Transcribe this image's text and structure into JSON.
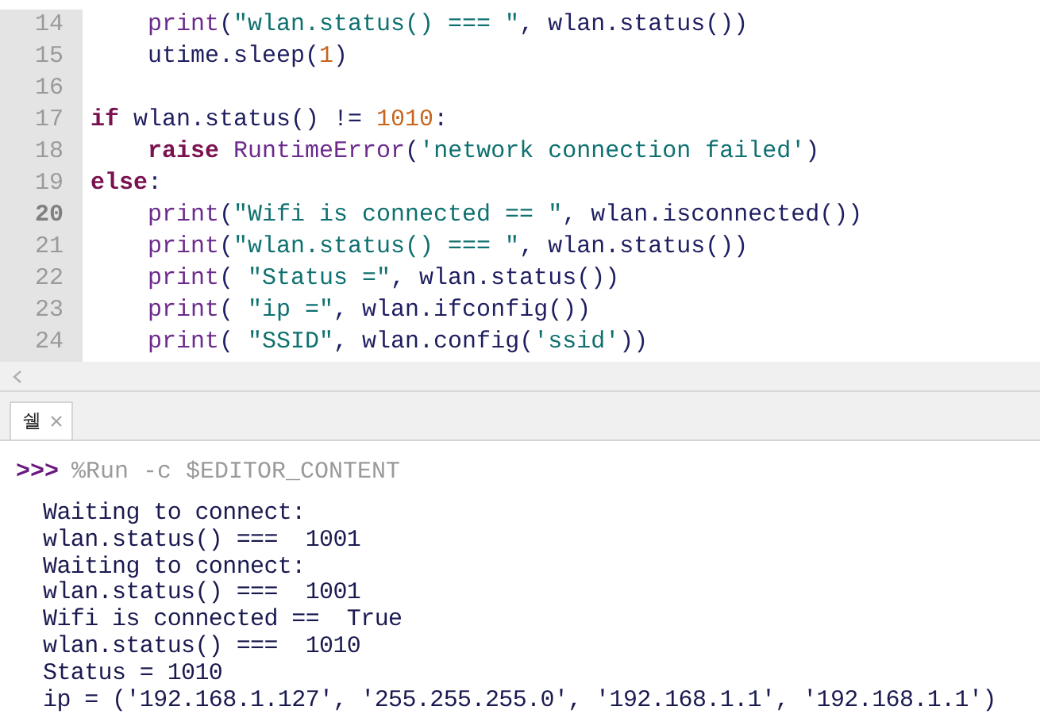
{
  "editor": {
    "lines": [
      {
        "number": "14",
        "current": false,
        "tokens": [
          {
            "kind": "builtin",
            "text": "    print"
          },
          {
            "kind": "plain",
            "text": "("
          },
          {
            "kind": "string",
            "text": "\"wlan.status() === \""
          },
          {
            "kind": "plain",
            "text": ", wlan.status())"
          }
        ]
      },
      {
        "number": "15",
        "current": false,
        "tokens": [
          {
            "kind": "plain",
            "text": "    utime.sleep("
          },
          {
            "kind": "number",
            "text": "1"
          },
          {
            "kind": "plain",
            "text": ")"
          }
        ]
      },
      {
        "number": "16",
        "current": false
      },
      {
        "number": "17",
        "current": false,
        "tokens": [
          {
            "kind": "keyword",
            "text": "if"
          },
          {
            "kind": "plain",
            "text": " wlan.status() != "
          },
          {
            "kind": "number",
            "text": "1010"
          },
          {
            "kind": "plain",
            "text": ":"
          }
        ]
      },
      {
        "number": "18",
        "current": false,
        "tokens": [
          {
            "kind": "keyword",
            "text": "    raise"
          },
          {
            "kind": "builtin",
            "text": " RuntimeError"
          },
          {
            "kind": "plain",
            "text": "("
          },
          {
            "kind": "string",
            "text": "'network connection failed'"
          },
          {
            "kind": "plain",
            "text": ")"
          }
        ]
      },
      {
        "number": "19",
        "current": false,
        "tokens": [
          {
            "kind": "keyword",
            "text": "else"
          },
          {
            "kind": "plain",
            "text": ":"
          }
        ]
      },
      {
        "number": "20",
        "current": true,
        "tokens": [
          {
            "kind": "builtin",
            "text": "    print"
          },
          {
            "kind": "plain",
            "text": "("
          },
          {
            "kind": "string",
            "text": "\"Wifi is connected == \""
          },
          {
            "kind": "plain",
            "text": ", wlan.isconnected())"
          }
        ]
      },
      {
        "number": "21",
        "current": false,
        "tokens": [
          {
            "kind": "builtin",
            "text": "    print"
          },
          {
            "kind": "plain",
            "text": "("
          },
          {
            "kind": "string",
            "text": "\"wlan.status() === \""
          },
          {
            "kind": "plain",
            "text": ", wlan.status())"
          }
        ]
      },
      {
        "number": "22",
        "current": false,
        "tokens": [
          {
            "kind": "builtin",
            "text": "    print"
          },
          {
            "kind": "plain",
            "text": "( "
          },
          {
            "kind": "string",
            "text": "\"Status =\""
          },
          {
            "kind": "plain",
            "text": ", wlan.status())"
          }
        ]
      },
      {
        "number": "23",
        "current": false,
        "tokens": [
          {
            "kind": "builtin",
            "text": "    print"
          },
          {
            "kind": "plain",
            "text": "( "
          },
          {
            "kind": "string",
            "text": "\"ip =\""
          },
          {
            "kind": "plain",
            "text": ", wlan.ifconfig())"
          }
        ]
      },
      {
        "number": "24",
        "current": false,
        "tokens": [
          {
            "kind": "builtin",
            "text": "    print"
          },
          {
            "kind": "plain",
            "text": "( "
          },
          {
            "kind": "string",
            "text": "\"SSID\""
          },
          {
            "kind": "plain",
            "text": ", wlan.config("
          },
          {
            "kind": "string",
            "text": "'ssid'"
          },
          {
            "kind": "plain",
            "text": "))"
          }
        ]
      }
    ]
  },
  "shell": {
    "tabs": [
      {
        "label": "쉘",
        "selected": true
      }
    ],
    "prompt": ">>>",
    "command": "%Run -c $EDITOR_CONTENT",
    "output": [
      "Waiting to connect:",
      "wlan.status() ===  1001",
      "Waiting to connect:",
      "wlan.status() ===  1001",
      "Wifi is connected ==  True",
      "wlan.status() ===  1010",
      "Status = 1010",
      "ip = ('192.168.1.127', '255.255.255.0', '192.168.1.1', '192.168.1.1')"
    ]
  }
}
